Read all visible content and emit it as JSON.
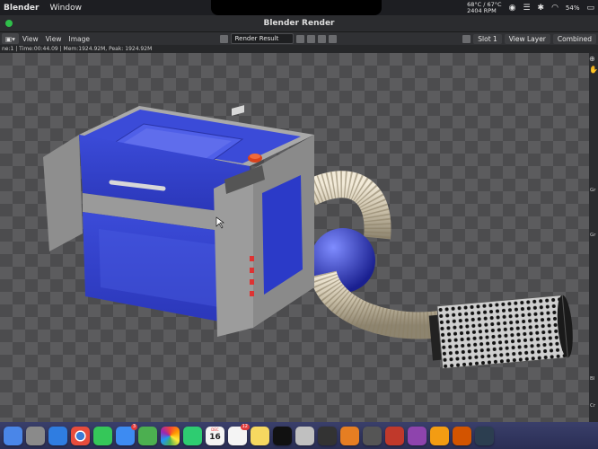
{
  "menubar": {
    "app_name": "Blender",
    "items": [
      "Window"
    ],
    "temps": [
      "68°C / 67°C",
      "2404 RPM"
    ],
    "battery": "54%"
  },
  "window": {
    "title": "Blender Render"
  },
  "toolbar": {
    "menus": [
      "View",
      "View",
      "Image"
    ],
    "image_name": "Render Result",
    "slot": "Slot 1",
    "view_layer": "View Layer",
    "pass": "Combined"
  },
  "info": {
    "text": "ne:1 | Time:00:44.09 | Mem:1924.92M, Peak: 1924.92M"
  },
  "sidebar": {
    "labels": [
      "Gr",
      "Gr",
      "Bl",
      "Cr"
    ]
  },
  "dock": {
    "calendar_month": "DEC",
    "calendar_day": "16",
    "mail_badge": "3",
    "reminders_badge": "12",
    "apps": [
      "finder-icon",
      "launchpad-icon",
      "safari-icon",
      "chrome-icon",
      "messages-icon",
      "mail-icon",
      "maps-icon",
      "photos-icon",
      "facetime-icon",
      "calendar-icon",
      "reminders-icon",
      "notes-icon",
      "appletv-icon",
      "app3-icon",
      "blender-icon",
      "app4-icon",
      "app5-icon",
      "app6-icon",
      "app7-icon",
      "app8-icon",
      "app9-icon",
      "app10-icon"
    ],
    "colors": [
      "#4a86e8",
      "#8a8a8a",
      "#2f7de1",
      "#ffffff",
      "#35c759",
      "#3d8bf2",
      "#4caf50",
      "#f0c040",
      "#2ecc71",
      "#f4f4f4",
      "#f4f4f4",
      "#f6d860",
      "#111111",
      "#c0c0c0",
      "#333333",
      "#e67e22",
      "#555555",
      "#c0392b",
      "#8e44ad",
      "#f39c12",
      "#d35400",
      "#2c3e50"
    ]
  }
}
